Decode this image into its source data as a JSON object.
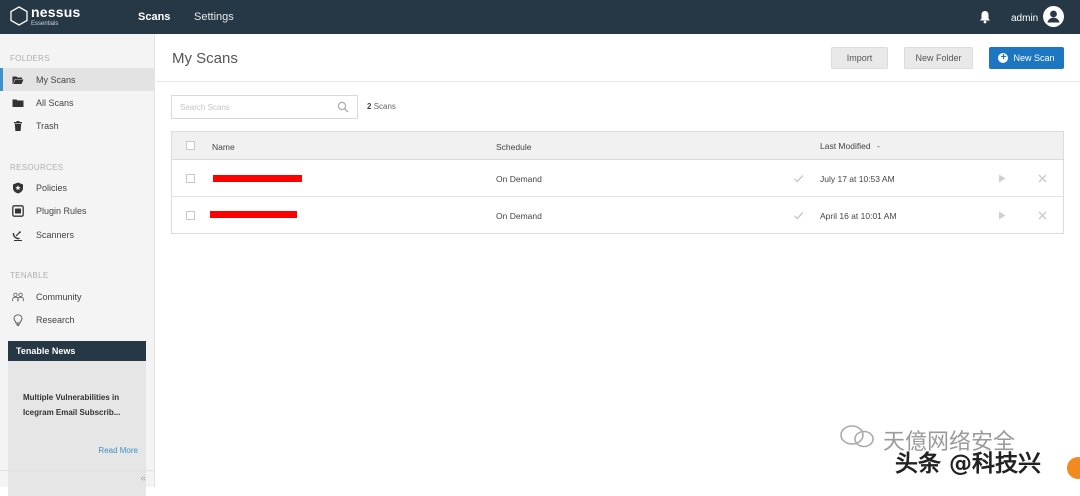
{
  "app": {
    "logo_name": "nessus",
    "logo_sub": "Essentials",
    "nav": [
      {
        "label": "Scans"
      },
      {
        "label": "Settings"
      }
    ],
    "user": "admin"
  },
  "sidebar": {
    "folders_heading": "FOLDERS",
    "folders": [
      {
        "label": "My Scans",
        "icon": "folder-open-icon"
      },
      {
        "label": "All Scans",
        "icon": "folder-icon"
      },
      {
        "label": "Trash",
        "icon": "trash-icon"
      }
    ],
    "resources_heading": "RESOURCES",
    "resources": [
      {
        "label": "Policies",
        "icon": "shield-icon"
      },
      {
        "label": "Plugin Rules",
        "icon": "plugin-icon"
      },
      {
        "label": "Scanners",
        "icon": "satellite-dish-icon"
      }
    ],
    "tenable_heading": "TENABLE",
    "tenable": [
      {
        "label": "Community",
        "icon": "community-icon"
      },
      {
        "label": "Research",
        "icon": "lightbulb-icon"
      }
    ],
    "news": {
      "heading": "Tenable News",
      "title": "Multiple Vulnerabilities in Icegram Email Subscrib...",
      "read_more": "Read More"
    },
    "collapse_glyph": "«"
  },
  "main": {
    "title": "My Scans",
    "buttons": {
      "import": "Import",
      "new_folder": "New Folder",
      "new_scan": "New Scan"
    },
    "search_placeholder": "Search Scans",
    "scan_count_num": "2",
    "scan_count_label": "Scans",
    "table": {
      "headers": {
        "name": "Name",
        "schedule": "Schedule",
        "last_modified": "Last Modified"
      },
      "sort_indicator": "-",
      "rows": [
        {
          "schedule": "On Demand",
          "last_modified": "July 17 at 10:53 AM"
        },
        {
          "schedule": "On Demand",
          "last_modified": "April 16 at 10:01 AM"
        }
      ]
    }
  },
  "watermark": {
    "line1": "天億网络安全",
    "line2": "头条 @科技兴"
  },
  "colors": {
    "topbar": "#263746",
    "accent": "#1d76c2",
    "redaction": "#ff0000"
  }
}
